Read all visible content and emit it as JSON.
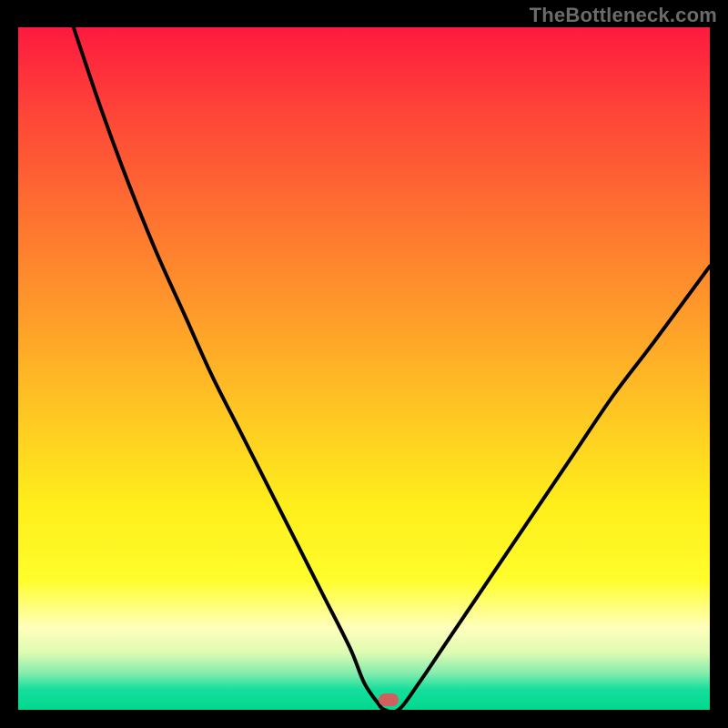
{
  "watermark": "TheBottleneck.com",
  "chart_data": {
    "type": "line",
    "title": "",
    "xlabel": "",
    "ylabel": "",
    "xlim": [
      0,
      100
    ],
    "ylim": [
      0,
      100
    ],
    "series": [
      {
        "name": "bottleneck-curve",
        "x": [
          8,
          12,
          16,
          20,
          24,
          28,
          32,
          36,
          40,
          44,
          48,
          50,
          52,
          53,
          55,
          58,
          62,
          68,
          74,
          80,
          86,
          92,
          100
        ],
        "values": [
          100,
          88,
          77,
          67,
          58,
          49,
          41,
          33,
          25,
          17,
          9,
          4,
          1,
          0,
          0,
          4,
          10,
          19,
          28,
          37,
          46,
          54,
          65
        ]
      }
    ],
    "annotations": [
      {
        "name": "minimum-marker",
        "x": 53.5,
        "y": 1.5
      }
    ],
    "background_gradient": {
      "top_color": "#fd1a3f",
      "mid_color": "#feef1b",
      "bottom_color": "#00d890"
    }
  }
}
